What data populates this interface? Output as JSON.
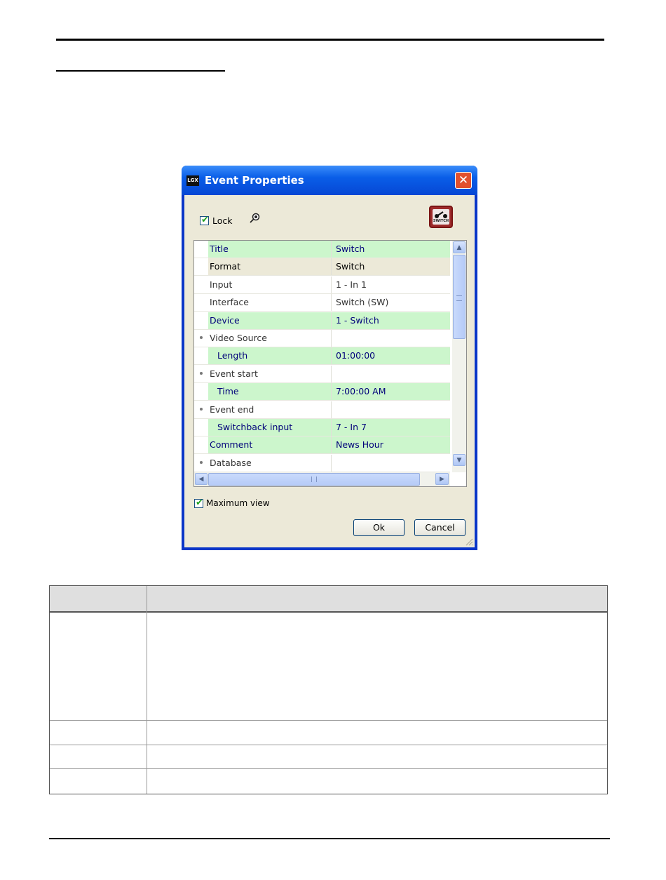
{
  "dialog": {
    "title": "Event Properties",
    "app_icon_text": "LGX",
    "close_glyph": "✕",
    "lock_label": "Lock",
    "lock_checked": true,
    "switch_icon_text": "SWITCH",
    "icons": {
      "app": "lgx-app-icon",
      "pin": "pin-icon",
      "switch": "switch-event-icon",
      "close": "close-icon"
    },
    "properties": [
      {
        "name": "Title",
        "value": "Switch",
        "style": "green",
        "indent": false,
        "expandable": false
      },
      {
        "name": "Format",
        "value": "Switch",
        "style": "tan",
        "indent": false,
        "expandable": false
      },
      {
        "name": "Input",
        "value": "1 - In 1",
        "style": "white",
        "indent": false,
        "expandable": false
      },
      {
        "name": "Interface",
        "value": "Switch (SW)",
        "style": "white",
        "indent": false,
        "expandable": false
      },
      {
        "name": "Device",
        "value": "1 - Switch",
        "style": "green",
        "indent": false,
        "expandable": false
      },
      {
        "name": "Video Source",
        "value": "",
        "style": "white",
        "indent": false,
        "expandable": true
      },
      {
        "name": "Length",
        "value": "01:00:00",
        "style": "green",
        "indent": true,
        "expandable": false
      },
      {
        "name": "Event start",
        "value": "",
        "style": "white",
        "indent": false,
        "expandable": true
      },
      {
        "name": "Time",
        "value": "7:00:00 AM",
        "style": "green",
        "indent": true,
        "expandable": false
      },
      {
        "name": "Event end",
        "value": "",
        "style": "white",
        "indent": false,
        "expandable": true
      },
      {
        "name": "Switchback input",
        "value": "7 - In 7",
        "style": "green",
        "indent": true,
        "expandable": false
      },
      {
        "name": "Comment",
        "value": "News Hour",
        "style": "green",
        "indent": false,
        "expandable": false
      },
      {
        "name": "Database",
        "value": "",
        "style": "white",
        "indent": false,
        "expandable": true
      }
    ],
    "scroll_up": "▲",
    "scroll_down": "▼",
    "scroll_left": "◀",
    "scroll_right": "▶",
    "max_view_label": "Maximum view",
    "max_view_checked": true,
    "ok_label": "Ok",
    "cancel_label": "Cancel"
  },
  "colors": {
    "title_blue": "#0a5ee8",
    "green_row": "#ccf6cc",
    "tan_row": "#ece9d8",
    "close_red": "#e2502d"
  }
}
